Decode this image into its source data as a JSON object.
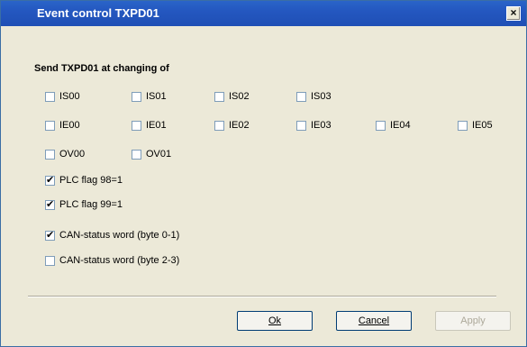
{
  "window": {
    "title": "Event control TXPD01",
    "close_glyph": "×"
  },
  "group": {
    "label": "Send TXPD01 at changing of"
  },
  "rows": {
    "is": [
      {
        "label": "IS00",
        "checked": false
      },
      {
        "label": "IS01",
        "checked": false
      },
      {
        "label": "IS02",
        "checked": false
      },
      {
        "label": "IS03",
        "checked": false
      }
    ],
    "ie": [
      {
        "label": "IE00",
        "checked": false
      },
      {
        "label": "IE01",
        "checked": false
      },
      {
        "label": "IE02",
        "checked": false
      },
      {
        "label": "IE03",
        "checked": false
      },
      {
        "label": "IE04",
        "checked": false
      },
      {
        "label": "IE05",
        "checked": false
      }
    ],
    "ov": [
      {
        "label": "OV00",
        "checked": false
      },
      {
        "label": "OV01",
        "checked": false
      }
    ]
  },
  "flags": [
    {
      "label": "PLC flag 98=1",
      "checked": true
    },
    {
      "label": "PLC flag 99=1",
      "checked": true
    }
  ],
  "can": [
    {
      "label": "CAN-status word (byte 0-1)",
      "checked": true
    },
    {
      "label": "CAN-status word (byte 2-3)",
      "checked": false
    }
  ],
  "buttons": {
    "ok": {
      "label": "Ok",
      "enabled": true
    },
    "cancel": {
      "label": "Cancel",
      "enabled": true
    },
    "apply": {
      "label": "Apply",
      "enabled": false
    }
  }
}
